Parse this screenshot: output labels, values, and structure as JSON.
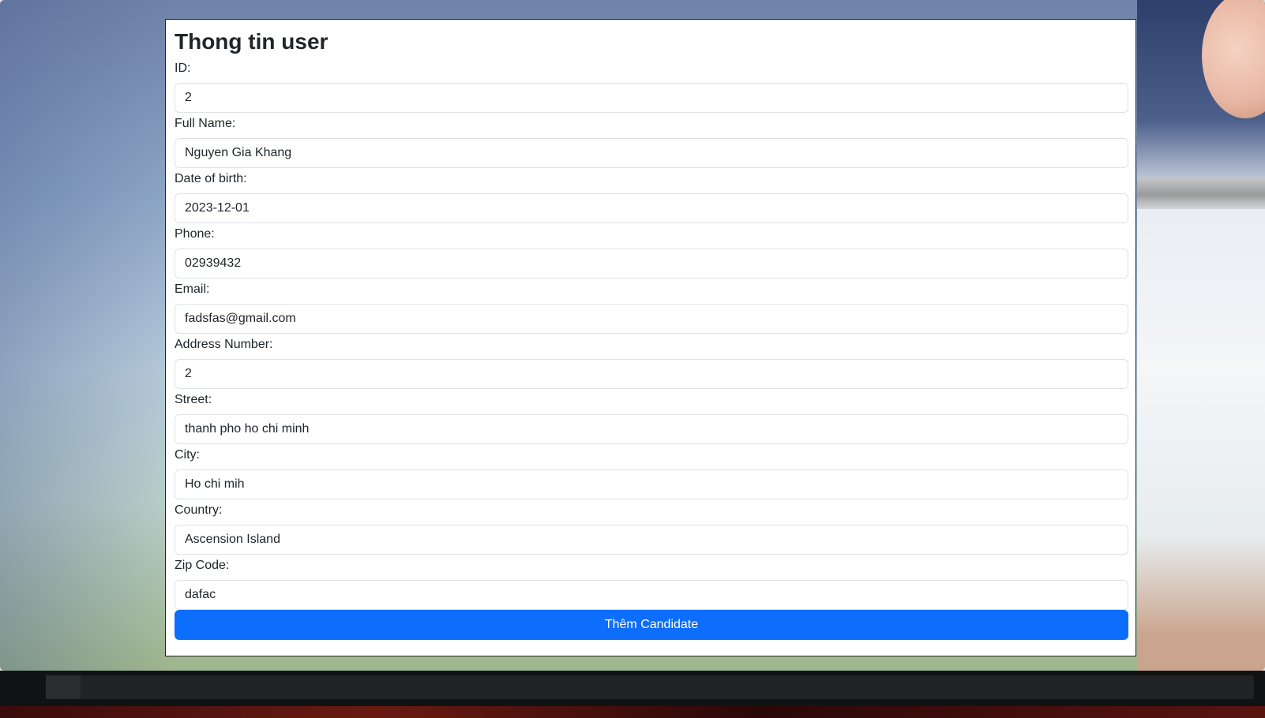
{
  "form": {
    "title": "Thong tin user",
    "fields": [
      {
        "label": "ID:",
        "value": "2"
      },
      {
        "label": "Full Name:",
        "value": "Nguyen Gia Khang"
      },
      {
        "label": "Date of birth:",
        "value": "2023-12-01"
      },
      {
        "label": "Phone:",
        "value": "02939432"
      },
      {
        "label": "Email:",
        "value": "fadsfas@gmail.com"
      },
      {
        "label": "Address Number:",
        "value": "2"
      },
      {
        "label": "Street:",
        "value": "thanh pho ho chi minh"
      },
      {
        "label": "City:",
        "value": "Ho chi mih"
      },
      {
        "label": "Country:",
        "value": "Ascension Island"
      },
      {
        "label": "Zip Code:",
        "value": "dafac"
      }
    ],
    "submit_label": "Thêm Candidate"
  },
  "colors": {
    "primary": "#0d6efd",
    "text": "#212529",
    "input_border": "#dee2e6"
  }
}
